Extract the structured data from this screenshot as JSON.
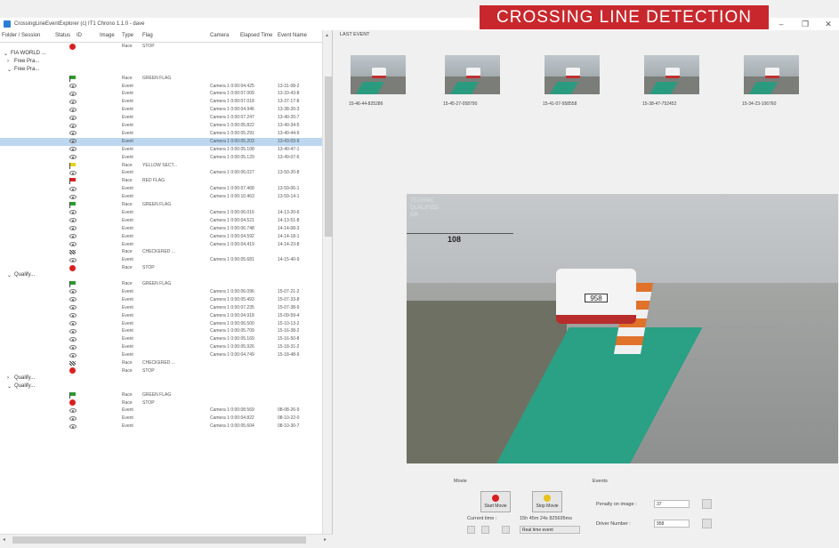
{
  "window": {
    "title": "CrossingLineEventExplorer (c) IT1 Chrono 1.1.0 - dave"
  },
  "banner": {
    "text": "CROSSING LINE DETECTION",
    "color": "#c8282d"
  },
  "winctl": {
    "minimize": "–",
    "maximize": "❐",
    "close": "✕"
  },
  "table": {
    "headers": {
      "folder": "Folder / Session",
      "status": "Status",
      "id": "ID",
      "image": "Image",
      "type": "Type",
      "flag": "Flag",
      "camera": "Camera",
      "elapsed": "Elapsed Time",
      "eventname": "Event Name"
    },
    "rows": [
      {
        "kind": "leaf",
        "icon": "stop",
        "type": "Race",
        "flag": "STOP",
        "camera": "",
        "event": ""
      },
      {
        "kind": "tree",
        "level": 0,
        "expander": "⌄",
        "label": "FIA WORLD ..."
      },
      {
        "kind": "tree",
        "level": 1,
        "expander": "›",
        "label": "Free Pra..."
      },
      {
        "kind": "tree",
        "level": 1,
        "expander": "⌄",
        "label": "Free Pra..."
      },
      {
        "kind": "leaf",
        "icon": "green",
        "type": "Race",
        "flag": "GREEN FLAG",
        "camera": "",
        "event": ""
      },
      {
        "kind": "leaf",
        "icon": "eye",
        "type": "Event",
        "flag": "",
        "camera": "Camera 1 0:00:04.425",
        "event": "13-31-08-2"
      },
      {
        "kind": "leaf",
        "icon": "eye",
        "type": "Event",
        "flag": "",
        "camera": "Camera 1 0:00:07.009",
        "event": "13-33-43-8"
      },
      {
        "kind": "leaf",
        "icon": "eye",
        "type": "Event",
        "flag": "",
        "camera": "Camera 1 0:00:07.018",
        "event": "13-37-17-8"
      },
      {
        "kind": "leaf",
        "icon": "eye",
        "type": "Event",
        "flag": "",
        "camera": "Camera 1 0:00:04.946",
        "event": "13-38-20-3"
      },
      {
        "kind": "leaf",
        "icon": "eye",
        "type": "Event",
        "flag": "",
        "camera": "Camera 1 0:00:07.247",
        "event": "13-40-20-7"
      },
      {
        "kind": "leaf",
        "icon": "eye",
        "type": "Event",
        "flag": "",
        "camera": "Camera 1 0:00:05.822",
        "event": "13-40-34-5"
      },
      {
        "kind": "leaf",
        "icon": "eye",
        "type": "Event",
        "flag": "",
        "camera": "Camera 1 0:00:05.291",
        "event": "13-40-44-9"
      },
      {
        "kind": "leaf",
        "icon": "eye",
        "type": "Event",
        "flag": "",
        "camera": "Camera 1 0:00:05.203",
        "event": "13-43-03-9",
        "selected": true
      },
      {
        "kind": "leaf",
        "icon": "eye",
        "type": "Event",
        "flag": "",
        "camera": "Camera 1 0:00:05.108",
        "event": "13-40-47-1"
      },
      {
        "kind": "leaf",
        "icon": "eye",
        "type": "Event",
        "flag": "",
        "camera": "Camera 1 0:00:05.129",
        "event": "13-49-07-6"
      },
      {
        "kind": "leaf",
        "icon": "yellow",
        "type": "Race",
        "flag": "YELLOW SECT...",
        "camera": "",
        "event": ""
      },
      {
        "kind": "leaf",
        "icon": "eye",
        "type": "Event",
        "flag": "",
        "camera": "Camera 1 0:00:06.027",
        "event": "13-50-20-8"
      },
      {
        "kind": "leaf",
        "icon": "red",
        "type": "Race",
        "flag": "RED FLAG",
        "camera": "",
        "event": ""
      },
      {
        "kind": "leaf",
        "icon": "eye",
        "type": "Event",
        "flag": "",
        "camera": "Camera 1 0:00:07.468",
        "event": "13-59-06-1"
      },
      {
        "kind": "leaf",
        "icon": "eye",
        "type": "Event",
        "flag": "",
        "camera": "Camera 1 0:00:10.463",
        "event": "13-59-14-1"
      },
      {
        "kind": "leaf",
        "icon": "green",
        "type": "Race",
        "flag": "GREEN FLAG",
        "camera": "",
        "event": ""
      },
      {
        "kind": "leaf",
        "icon": "eye",
        "type": "Event",
        "flag": "",
        "camera": "Camera 1 0:00:06.016",
        "event": "14-13-20-6"
      },
      {
        "kind": "leaf",
        "icon": "eye",
        "type": "Event",
        "flag": "",
        "camera": "Camera 1 0:00:04.521",
        "event": "14-13-51-8"
      },
      {
        "kind": "leaf",
        "icon": "eye",
        "type": "Event",
        "flag": "",
        "camera": "Camera 1 0:00:06.748",
        "event": "14-14-08-3"
      },
      {
        "kind": "leaf",
        "icon": "eye",
        "type": "Event",
        "flag": "",
        "camera": "Camera 1 0:00:04.592",
        "event": "14-14-18-1"
      },
      {
        "kind": "leaf",
        "icon": "eye",
        "type": "Event",
        "flag": "",
        "camera": "Camera 1 0:00:04.419",
        "event": "14-14-23-8"
      },
      {
        "kind": "leaf",
        "icon": "chequered",
        "type": "Race",
        "flag": "CHECKERED ...",
        "camera": "",
        "event": ""
      },
      {
        "kind": "leaf",
        "icon": "eye",
        "type": "Event",
        "flag": "",
        "camera": "Camera 1 0:00:05.681",
        "event": "14-15-40-9"
      },
      {
        "kind": "leaf",
        "icon": "stop",
        "type": "Race",
        "flag": "STOP",
        "camera": "",
        "event": ""
      },
      {
        "kind": "tree",
        "level": 1,
        "expander": "⌄",
        "label": "Qualify..."
      },
      {
        "kind": "leaf",
        "icon": "green",
        "type": "Race",
        "flag": "GREEN FLAG",
        "camera": "",
        "event": ""
      },
      {
        "kind": "leaf",
        "icon": "eye",
        "type": "Event",
        "flag": "",
        "camera": "Camera 1 0:00:06.096",
        "event": "15-07-21-2"
      },
      {
        "kind": "leaf",
        "icon": "eye",
        "type": "Event",
        "flag": "",
        "camera": "Camera 1 0:00:05.493",
        "event": "15-07-33-8"
      },
      {
        "kind": "leaf",
        "icon": "eye",
        "type": "Event",
        "flag": "",
        "camera": "Camera 1 0:00:07.235",
        "event": "15-07-38-9"
      },
      {
        "kind": "leaf",
        "icon": "eye",
        "type": "Event",
        "flag": "",
        "camera": "Camera 1 0:00:04.918",
        "event": "15-09-59-4"
      },
      {
        "kind": "leaf",
        "icon": "eye",
        "type": "Event",
        "flag": "",
        "camera": "Camera 1 0:00:06.500",
        "event": "15-10-13-2"
      },
      {
        "kind": "leaf",
        "icon": "eye",
        "type": "Event",
        "flag": "",
        "camera": "Camera 1 0:00:05.709",
        "event": "15-16-38-2"
      },
      {
        "kind": "leaf",
        "icon": "eye",
        "type": "Event",
        "flag": "",
        "camera": "Camera 1 0:00:05.169",
        "event": "15-16-50-8"
      },
      {
        "kind": "leaf",
        "icon": "eye",
        "type": "Event",
        "flag": "",
        "camera": "Camera 1 0:00:05.926",
        "event": "15-18-31-2"
      },
      {
        "kind": "leaf",
        "icon": "eye",
        "type": "Event",
        "flag": "",
        "camera": "Camera 1 0:00:04.749",
        "event": "15-18-48-9"
      },
      {
        "kind": "leaf",
        "icon": "chequered",
        "type": "Race",
        "flag": "CHECKERED ...",
        "camera": "",
        "event": ""
      },
      {
        "kind": "leaf",
        "icon": "stop",
        "type": "Race",
        "flag": "STOP",
        "camera": "",
        "event": ""
      },
      {
        "kind": "tree",
        "level": 1,
        "expander": "›",
        "label": "Qualify..."
      },
      {
        "kind": "tree",
        "level": 1,
        "expander": "⌄",
        "label": "Qualify..."
      },
      {
        "kind": "leaf",
        "icon": "green",
        "type": "Race",
        "flag": "GREEN FLAG",
        "camera": "",
        "event": ""
      },
      {
        "kind": "leaf",
        "icon": "stop",
        "type": "Race",
        "flag": "STOP",
        "camera": "",
        "event": ""
      },
      {
        "kind": "leaf",
        "icon": "eye",
        "type": "Event",
        "flag": "",
        "camera": "Camera 1 0:00:08.569",
        "event": "08-08-26-9"
      },
      {
        "kind": "leaf",
        "icon": "eye",
        "type": "Event",
        "flag": "",
        "camera": "Camera 1 0:00:04.822",
        "event": "08-10-22-0"
      },
      {
        "kind": "leaf",
        "icon": "eye",
        "type": "Event",
        "flag": "",
        "camera": "Camera 1 0:00:05.604",
        "event": "08-10-30-7"
      }
    ]
  },
  "last_event": {
    "label": "LAST EVENT",
    "thumbs": [
      "15-46-44-825286",
      "15-45-27-058790",
      "15-41-07-958558",
      "15-38-47-752452",
      "15-34-23-106760"
    ]
  },
  "main_image": {
    "overlay_lines": [
      "TECHNIC",
      "QUALIFIED",
      "GR"
    ],
    "sign": "108",
    "car_number": "958"
  },
  "movie": {
    "group_label": "Movie",
    "start_label": "Start Movie",
    "stop_label": "Stop Movie",
    "current_time_label": "Current time :",
    "current_time_value": "15h 45m 24s 825695ms",
    "mode_value": "Real time event"
  },
  "events": {
    "group_label": "Events",
    "penalty_label": "Penalty on image :",
    "penalty_value": "37",
    "driver_label": "Driver Number :",
    "driver_value": "958"
  },
  "colors": {
    "green": "#2c9a2c",
    "yellow": "#e6d21a",
    "red": "#d92020",
    "selection": "#bcd7ef"
  }
}
